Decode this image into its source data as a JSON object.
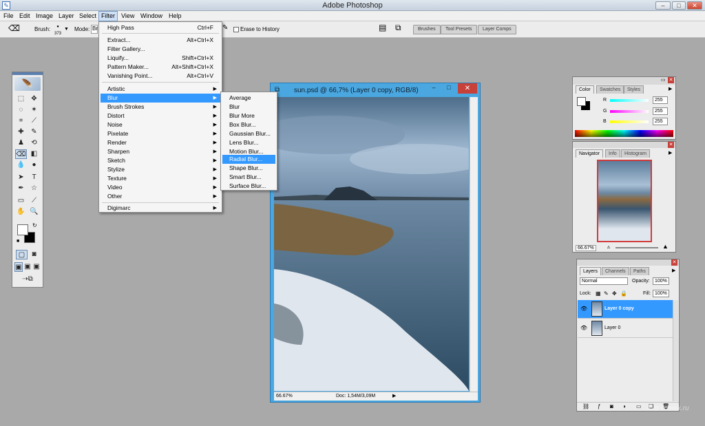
{
  "app": {
    "title": "Adobe Photoshop",
    "minimize": "–",
    "maximize": "□",
    "close": "✕"
  },
  "menubar": [
    "File",
    "Edit",
    "Image",
    "Layer",
    "Select",
    "Filter",
    "View",
    "Window",
    "Help"
  ],
  "options": {
    "brush_label": "Brush:",
    "brush_size": "373",
    "mode_label": "Mode:",
    "mode_value": "Br",
    "erase_history": "Erase to History"
  },
  "wells": [
    "Brushes",
    "Tool Presets",
    "Layer Comps"
  ],
  "filter_menu": {
    "items": [
      {
        "label": "High Pass",
        "shortcut": "Ctrl+F"
      },
      {
        "label": "Extract...",
        "shortcut": "Alt+Ctrl+X"
      },
      {
        "label": "Filter Gallery...",
        "shortcut": ""
      },
      {
        "label": "Liquify...",
        "shortcut": "Shift+Ctrl+X"
      },
      {
        "label": "Pattern Maker...",
        "shortcut": "Alt+Shift+Ctrl+X"
      },
      {
        "label": "Vanishing Point...",
        "shortcut": "Alt+Ctrl+V"
      },
      {
        "label": "Artistic",
        "shortcut": ""
      },
      {
        "label": "Blur",
        "shortcut": ""
      },
      {
        "label": "Brush Strokes",
        "shortcut": ""
      },
      {
        "label": "Distort",
        "shortcut": ""
      },
      {
        "label": "Noise",
        "shortcut": ""
      },
      {
        "label": "Pixelate",
        "shortcut": ""
      },
      {
        "label": "Render",
        "shortcut": ""
      },
      {
        "label": "Sharpen",
        "shortcut": ""
      },
      {
        "label": "Sketch",
        "shortcut": ""
      },
      {
        "label": "Stylize",
        "shortcut": ""
      },
      {
        "label": "Texture",
        "shortcut": ""
      },
      {
        "label": "Video",
        "shortcut": ""
      },
      {
        "label": "Other",
        "shortcut": ""
      },
      {
        "label": "Digimarc",
        "shortcut": ""
      }
    ]
  },
  "blur_menu": [
    "Average",
    "Blur",
    "Blur More",
    "Box Blur...",
    "Gaussian Blur...",
    "Lens Blur...",
    "Motion Blur...",
    "Radial Blur...",
    "Shape Blur...",
    "Smart Blur...",
    "Surface Blur..."
  ],
  "document": {
    "title": "sun.psd @ 66,7% (Layer 0 copy, RGB/8)",
    "zoom": "66.67%",
    "doc_info": "Doc: 1,54M/3,09M"
  },
  "color_panel": {
    "tabs": [
      "Color",
      "Swatches",
      "Styles"
    ],
    "channels": [
      {
        "label": "R",
        "value": "255"
      },
      {
        "label": "G",
        "value": "255"
      },
      {
        "label": "B",
        "value": "255"
      }
    ]
  },
  "navigator_panel": {
    "tabs": [
      "Navigator",
      "Info",
      "Histogram"
    ],
    "zoom": "66.67%"
  },
  "layers_panel": {
    "tabs": [
      "Layers",
      "Channels",
      "Paths"
    ],
    "blend_mode": "Normal",
    "opacity_label": "Opacity:",
    "opacity": "100%",
    "lock_label": "Lock:",
    "fill_label": "Fill:",
    "fill": "100%",
    "layers": [
      {
        "name": "Layer 0 copy"
      },
      {
        "name": "Layer 0"
      }
    ]
  },
  "watermark": "foto komok.ru"
}
